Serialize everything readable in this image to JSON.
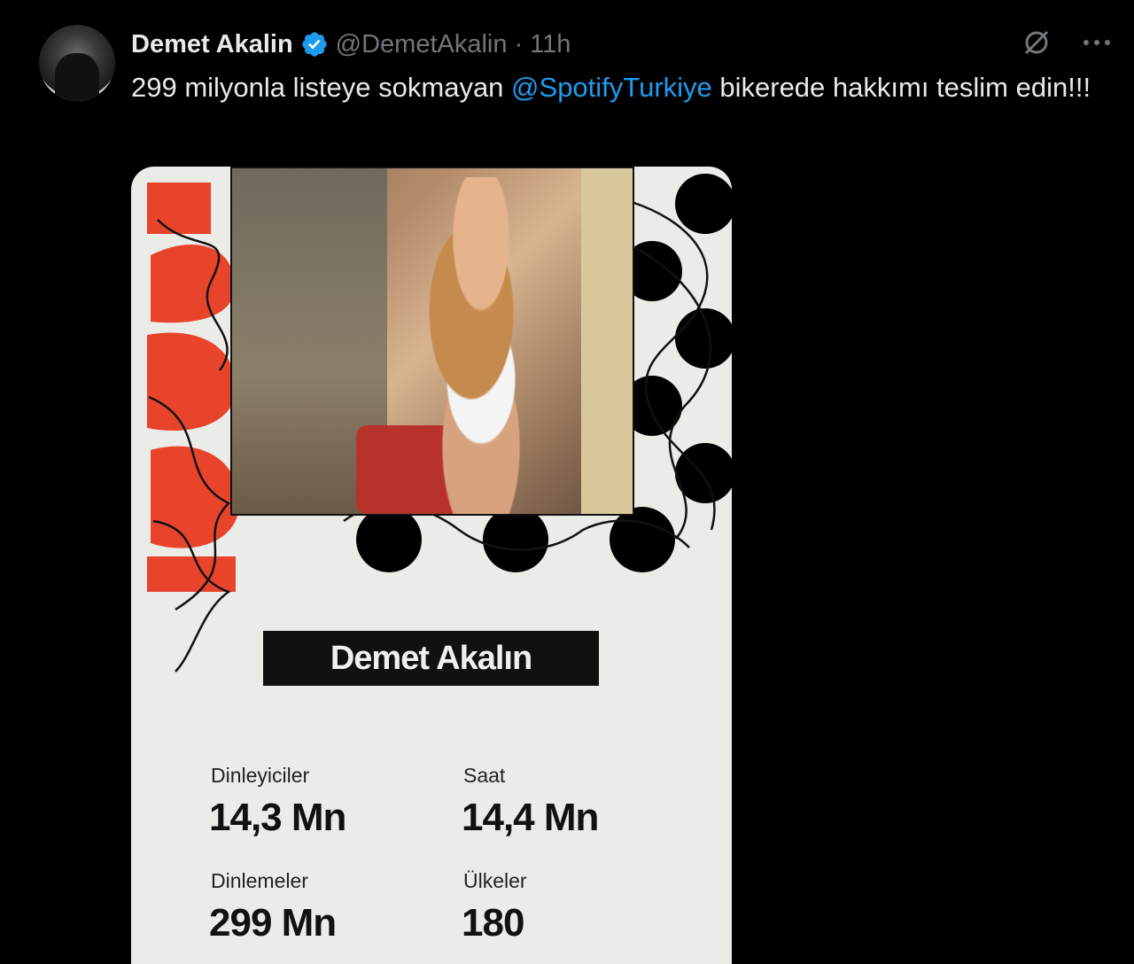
{
  "tweet": {
    "display_name": "Demet Akalin",
    "handle": "@DemetAkalin",
    "separator": "·",
    "time": "11h",
    "text_before": "299 milyonla listeye sokmayan ",
    "mention": "@SpotifyTurkiye",
    "text_after": "  bikerede hakkımı teslim edin!!!"
  },
  "icons": {
    "verified": "verified-badge-icon",
    "grok": "grok-icon",
    "more": "more-options-icon"
  },
  "colors": {
    "accent": "#1d9bf0",
    "background": "#000000",
    "card_background": "#ebebe8",
    "brand_red": "#e8442c"
  },
  "card": {
    "artist_name": "Demet Akalın",
    "stats": [
      {
        "label": "Dinleyiciler",
        "value": "14,3 Mn"
      },
      {
        "label": "Saat",
        "value": "14,4 Mn"
      },
      {
        "label": "Dinlemeler",
        "value": "299 Mn"
      },
      {
        "label": "Ülkeler",
        "value": "180"
      }
    ]
  }
}
